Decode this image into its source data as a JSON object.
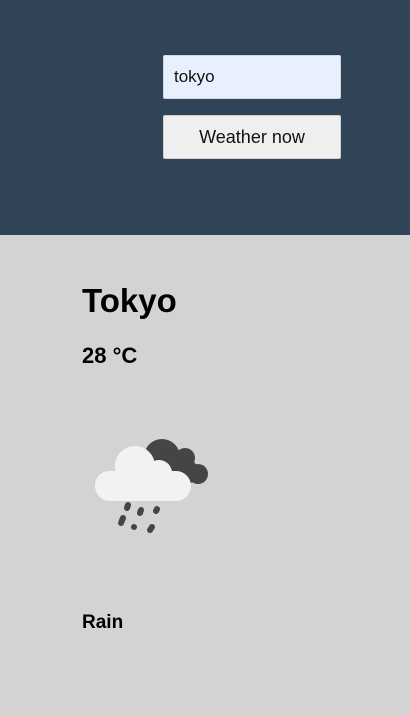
{
  "search": {
    "city_value": "tokyo",
    "button_label": "Weather now"
  },
  "weather": {
    "city": "Tokyo",
    "temperature": "28 °C",
    "condition": "Rain",
    "icon": "rain-cloud-icon"
  },
  "colors": {
    "header_background": "#314457",
    "content_background": "#d3d3d3",
    "input_background": "#e8f0fe",
    "button_background": "#efefef"
  }
}
